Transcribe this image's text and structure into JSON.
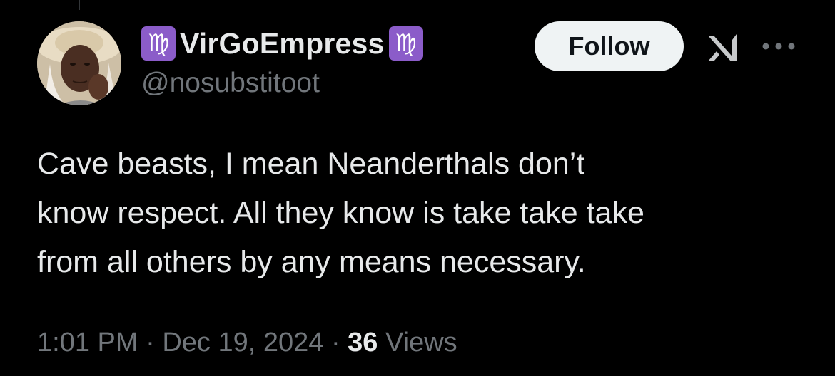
{
  "author": {
    "zodiac_symbol": "♍",
    "display_name": "VirGoEmpress",
    "handle": "@nosubstitoot",
    "zodiac_badge_color": "#8b5cc9"
  },
  "actions": {
    "follow_label": "Follow",
    "grok_icon": "grok-icon",
    "more_icon": "more-horizontal-icon"
  },
  "tweet": {
    "lines": [
      "Cave beasts, I mean Neanderthals don’t",
      "know respect. All they know is take take take",
      "from all others by any means necessary."
    ]
  },
  "meta": {
    "time": "1:01 PM",
    "separator": "·",
    "date": "Dec 19, 2024",
    "views_count": "36",
    "views_label": "Views"
  },
  "colors": {
    "background": "#000000",
    "primary_text": "#e7e9ea",
    "secondary_text": "#71767b",
    "follow_button_bg": "#eff3f4"
  }
}
